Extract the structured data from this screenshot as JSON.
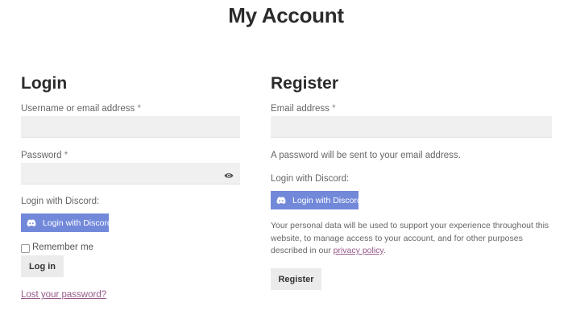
{
  "page": {
    "title": "My Account"
  },
  "login": {
    "heading": "Login",
    "username_label": "Username or email address",
    "required_mark": "*",
    "username_value": "",
    "password_label": "Password",
    "password_value": "",
    "discord_label": "Login with Discord:",
    "discord_button": "Login with Discord",
    "remember_label": "Remember me",
    "remember_checked": false,
    "login_button": "Log in",
    "lost_password_link": "Lost your password?"
  },
  "register": {
    "heading": "Register",
    "email_label": "Email address",
    "required_mark": "*",
    "email_value": "",
    "password_note": "A password will be sent to your email address.",
    "discord_label": "Login with Discord:",
    "discord_button": "Login with Discord",
    "privacy_text_before": "Your personal data will be used to support your experience throughout this website, to manage access to your account, and for other purposes described in our ",
    "privacy_link": "privacy policy",
    "privacy_text_after": ".",
    "register_button": "Register"
  },
  "colors": {
    "discord": "#7289da",
    "link": "#96588a",
    "field_bg": "#f0f0f0",
    "button_bg": "#ebebeb"
  },
  "icons": {
    "password_toggle": "eye-icon",
    "discord": "discord-icon"
  }
}
